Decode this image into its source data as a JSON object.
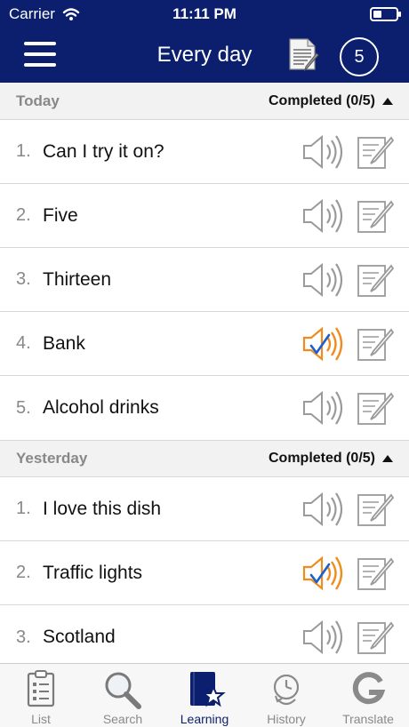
{
  "status_bar": {
    "carrier": "Carrier",
    "time": "11:11 PM"
  },
  "nav": {
    "title": "Every day",
    "badge_count": "5"
  },
  "sections": [
    {
      "label": "Today",
      "status": "Completed (0/5)",
      "items": [
        {
          "num": "1.",
          "text": "Can I try it on?",
          "audio_active": false
        },
        {
          "num": "2.",
          "text": "Five",
          "audio_active": false
        },
        {
          "num": "3.",
          "text": "Thirteen",
          "audio_active": false
        },
        {
          "num": "4.",
          "text": "Bank",
          "audio_active": true
        },
        {
          "num": "5.",
          "text": "Alcohol drinks",
          "audio_active": false
        }
      ]
    },
    {
      "label": "Yesterday",
      "status": "Completed (0/5)",
      "items": [
        {
          "num": "1.",
          "text": "I love this dish",
          "audio_active": false
        },
        {
          "num": "2.",
          "text": "Traffic lights",
          "audio_active": true
        },
        {
          "num": "3.",
          "text": "Scotland",
          "audio_active": false
        }
      ]
    }
  ],
  "tabs": [
    {
      "label": "List",
      "icon": "clipboard-icon",
      "active": false
    },
    {
      "label": "Search",
      "icon": "magnifier-icon",
      "active": false
    },
    {
      "label": "Learning",
      "icon": "book-star-icon",
      "active": true
    },
    {
      "label": "History",
      "icon": "clock-history-icon",
      "active": false
    },
    {
      "label": "Translate",
      "icon": "google-g-icon",
      "active": false
    }
  ],
  "colors": {
    "header": "#0b1f6e",
    "accent_orange": "#f08c1e",
    "check_blue": "#1a5fd0",
    "inactive_gray": "#9a9a9a"
  }
}
